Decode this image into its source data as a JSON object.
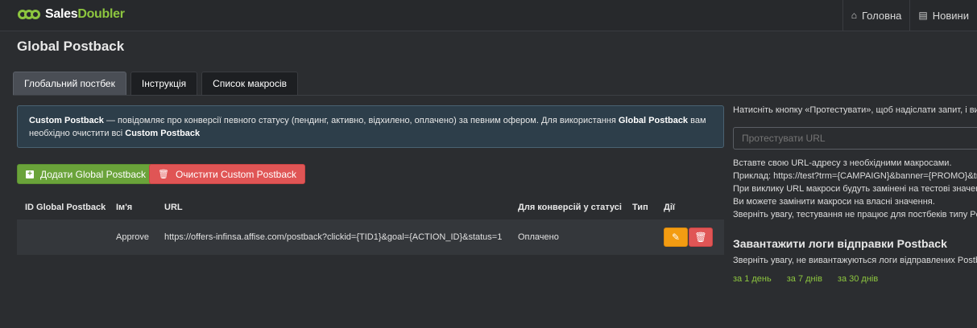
{
  "brand": {
    "name_main": "Sales",
    "name_accent": "Doubler",
    "accent_color": "#8dc63f"
  },
  "topnav": [
    {
      "icon": "home-icon",
      "label": "Головна"
    },
    {
      "icon": "news-icon",
      "label": "Новини"
    }
  ],
  "page_title": "Global Postback",
  "tabs": [
    {
      "label": "Глобальний постбек",
      "active": true
    },
    {
      "label": "Інструкція",
      "active": false
    },
    {
      "label": "Список макросів",
      "active": false
    }
  ],
  "info": {
    "bold1": "Custom Postback",
    "text1": " — повідомляє про конверсії певного статусу (пендинг, активно, відхилено, оплачено) за певним офером.  Для використання ",
    "bold2": "Global Postback",
    "text2": " вам необхідно очистити всі ",
    "bold3": "Custom Postback"
  },
  "buttons": {
    "add": "Додати Global Postback",
    "clear": "Очистити Custom Postback"
  },
  "table": {
    "headers": {
      "id": "ID Global Postback",
      "name": "Ім'я",
      "url": "URL",
      "status": "Для конверсій у статусі",
      "type": "Тип",
      "actions": "Дії"
    },
    "rows": [
      {
        "id": "",
        "name": "Approve",
        "url": "https://offers-infinsa.affise.com/postback?clickid={TID1}&goal={ACTION_ID}&status=1",
        "status": "Оплачено",
        "type": ""
      }
    ]
  },
  "right": {
    "intro": "Натисніть кнопку «Протестувати», щоб надіслати запит, і ви п",
    "test_placeholder": "Протестувати URL",
    "help_lines": [
      "Вставте свою URL-адресу з необхідними макросами.",
      "Приклад: https://test?trm={CAMPAIGN}&banner={PROMO}&trans",
      "При виклику URL макроси будуть замінені на тестові значенн",
      "Ви можете замінити макроси на власні значення.",
      "Зверніть увагу, тестування не працює для постбеків типу Pos"
    ],
    "logs_title": "Завантажити логи відправки Postback",
    "logs_note": "Зверніть увагу, не вивантажуються логи відправлених Postba",
    "log_links": [
      "за 1 день",
      "за 7 днів",
      "за 30 днів"
    ]
  }
}
